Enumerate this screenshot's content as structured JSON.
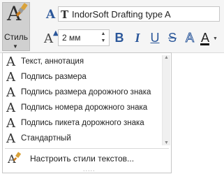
{
  "ribbon": {
    "style_button": {
      "label": "Стиль",
      "icon": "text-style-brush-icon"
    },
    "font": {
      "icon": "font-icon",
      "truetype_icon": "truetype-icon",
      "name": "IndorSoft Drafting type A"
    },
    "size": {
      "icon": "font-size-icon",
      "value": "2 мм"
    },
    "format": {
      "bold": "B",
      "italic": "I",
      "underline": "U",
      "strikethrough": "S",
      "outline": "A",
      "color": "A",
      "color_value": "#111111"
    }
  },
  "dropdown": {
    "items": [
      {
        "glyph": "A",
        "label": "Текст, аннотация"
      },
      {
        "glyph": "A",
        "label": "Подпись размера"
      },
      {
        "glyph": "A",
        "label": "Подпись размера дорожного знака"
      },
      {
        "glyph": "A",
        "label": "Подпись номера дорожного знака"
      },
      {
        "glyph": "A",
        "label": "Подпись пикета дорожного знака"
      },
      {
        "glyph": "A",
        "label": "Стандартный"
      }
    ],
    "settings_label": "Настроить стили текстов...",
    "grip": "....."
  },
  "colors": {
    "accent": "#2b579a",
    "ribbon_bg": "#f5f5f5",
    "pressed": "#d0d0d0"
  }
}
